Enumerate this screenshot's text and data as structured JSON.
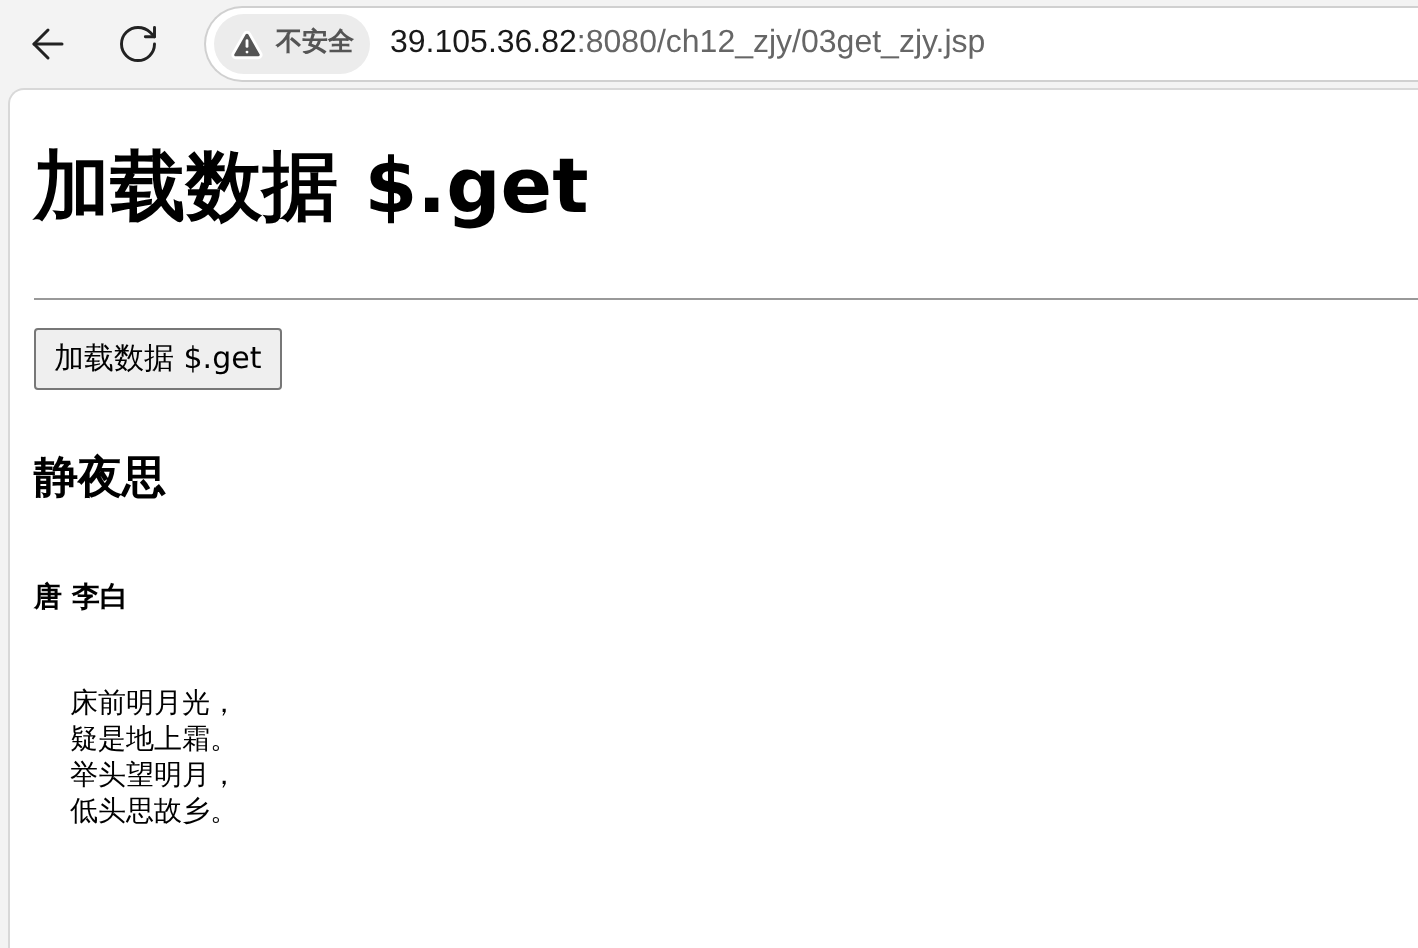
{
  "toolbar": {
    "security_badge": "不安全",
    "address": {
      "host": "39.105.36.82",
      "path": ":8080/ch12_zjy/03get_zjy.jsp"
    }
  },
  "page": {
    "heading": "加载数据 $.get",
    "button": "加载数据 $.get",
    "poem_title": "静夜思",
    "poem_author": "唐 李白",
    "poem_lines": [
      "床前明月光，",
      "疑是地上霜。",
      "举头望明月，",
      "低头思故乡。"
    ]
  }
}
